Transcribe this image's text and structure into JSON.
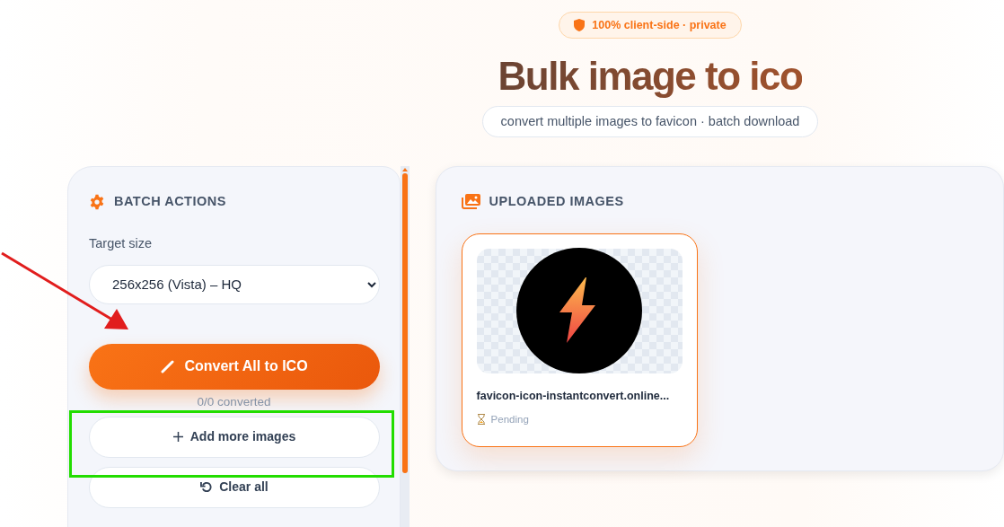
{
  "badge": "100% client-side · private",
  "title": "Bulk image to ico",
  "subtitle": "convert multiple images to favicon · batch download",
  "batch_actions": {
    "heading": "BATCH ACTIONS",
    "target_size_label": "Target size",
    "target_size_value": "256x256 (Vista) – HQ",
    "convert_button": "Convert All to ICO",
    "progress": "0/0 converted",
    "add_button": "Add more images",
    "clear_button": "Clear all"
  },
  "uploaded_images": {
    "heading": "UPLOADED IMAGES",
    "items": [
      {
        "filename": "favicon-icon-instantconvert.online...",
        "status": "Pending",
        "selected": true
      }
    ]
  }
}
